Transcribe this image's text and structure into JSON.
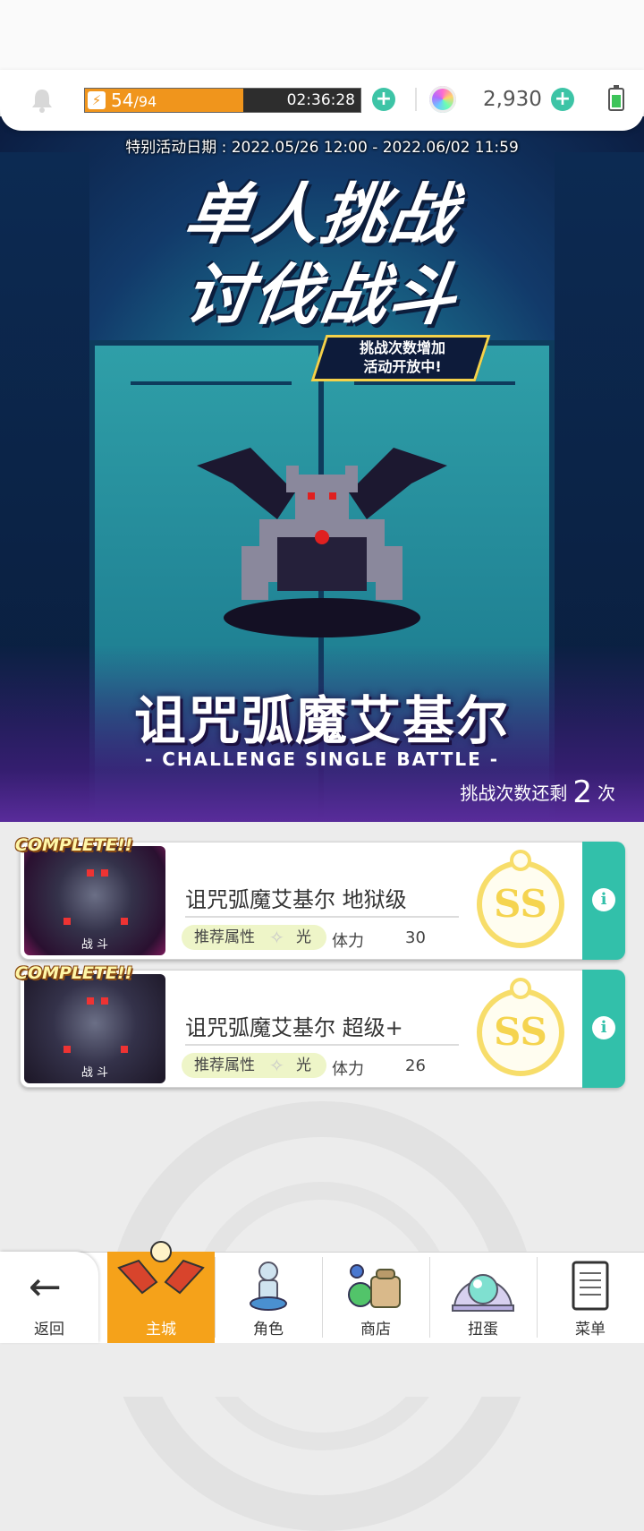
{
  "header": {
    "stamina_current": "54",
    "stamina_max": "/94",
    "stamina_fraction": 0.574,
    "stamina_timer": "02:36:28",
    "gems": "2,930",
    "colors": {
      "stamina": "#f0951c",
      "accent": "#3dc4a6"
    }
  },
  "banner": {
    "event_date": "特别活动日期 : 2022.05/26 12:00 - 2022.06/02 11:59",
    "title_line1": "单人挑战",
    "title_line2": "讨伐战斗",
    "promo_line1": "挑战次数增加",
    "promo_line2": "活动开放中!",
    "boss_name": "诅咒弧魔艾基尔",
    "subtitle": "- CHALLENGE SINGLE BATTLE -",
    "remaining_prefix": "挑战次数还剩",
    "remaining_count": "2",
    "remaining_suffix": "次"
  },
  "stages": [
    {
      "badge": "COMPLETE!!",
      "thumb_label": "战 斗",
      "name": "诅咒弧魔艾基尔 地狱级",
      "attr_label": "推荐属性",
      "attr_icon": "light-star-icon",
      "attr_value": "光",
      "stamina_label": "体力",
      "stamina_cost": "30",
      "rank": "SS"
    },
    {
      "badge": "COMPLETE!!",
      "thumb_label": "战 斗",
      "name": "诅咒弧魔艾基尔 超级+",
      "attr_label": "推荐属性",
      "attr_icon": "light-star-icon",
      "attr_value": "光",
      "stamina_label": "体力",
      "stamina_cost": "26",
      "rank": "SS"
    }
  ],
  "nav": {
    "back": "返回",
    "home": "主城",
    "characters": "角色",
    "shop": "商店",
    "gacha": "扭蛋",
    "menu": "菜单"
  }
}
